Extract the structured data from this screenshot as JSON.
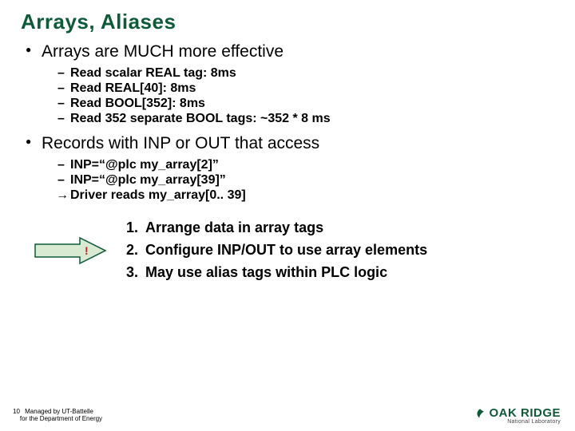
{
  "title": "Arrays, Aliases",
  "bullets": [
    {
      "text": "Arrays are MUCH more effective",
      "sub": [
        {
          "style": "dash",
          "text": "Read scalar REAL tag: 8ms"
        },
        {
          "style": "dash",
          "text": "Read REAL[40]: 8ms"
        },
        {
          "style": "dash",
          "text": "Read BOOL[352]: 8ms"
        },
        {
          "style": "dash",
          "text": "Read 352 separate BOOL tags: ~352 * 8 ms"
        }
      ]
    },
    {
      "text": "Records with INP or OUT that access",
      "sub": [
        {
          "style": "dash",
          "text": "INP=“@plc my_array[2]”"
        },
        {
          "style": "dash",
          "text": "INP=“@plc my_array[39]”"
        },
        {
          "style": "arrow",
          "text": "Driver reads my_array[0.. 39]"
        }
      ]
    }
  ],
  "callout_label": "!",
  "steps": [
    "Arrange data in array tags",
    "Configure INP/OUT to use array elements",
    "May use alias tags within PLC logic"
  ],
  "footer": {
    "page": "10",
    "line1": "Managed by UT-Battelle",
    "line2": "for the Department of Energy"
  },
  "logo": {
    "brand": "OAK RIDGE",
    "sub": "National Laboratory"
  }
}
